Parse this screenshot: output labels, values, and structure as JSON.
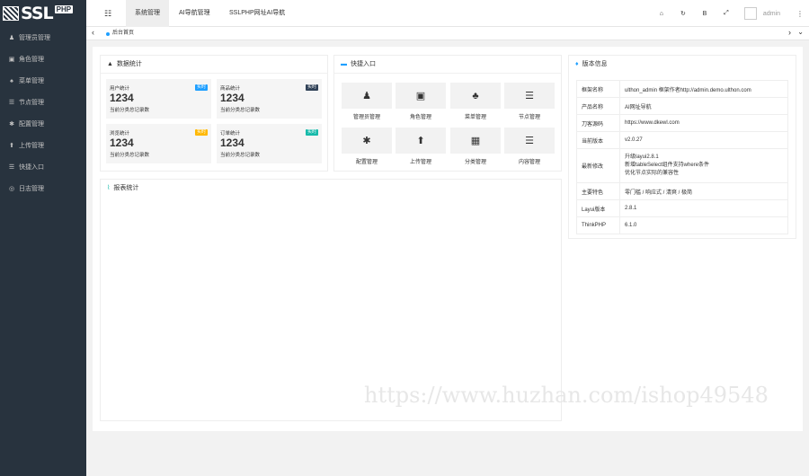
{
  "logo": {
    "text": "SSL",
    "sub": "PHP"
  },
  "sidebar": {
    "items": [
      {
        "label": "管理员管理",
        "icon": "♟"
      },
      {
        "label": "角色管理",
        "icon": "▣"
      },
      {
        "label": "菜单管理",
        "icon": "♠"
      },
      {
        "label": "节点管理",
        "icon": "☰"
      },
      {
        "label": "配置管理",
        "icon": "✱"
      },
      {
        "label": "上传管理",
        "icon": "⬆"
      },
      {
        "label": "快捷入口",
        "icon": "☰"
      },
      {
        "label": "日志管理",
        "icon": "◎"
      }
    ]
  },
  "header": {
    "menu_icon": "☷",
    "tabs": [
      "系统管理",
      "AI导航管理",
      "SSLPHP网址AI导航"
    ],
    "icons": [
      "⌂",
      "↻",
      "B",
      "⤢"
    ],
    "user": "admin",
    "dots": "⋮"
  },
  "tabbar": {
    "left": "‹",
    "tab": "后台首页",
    "right1": "›",
    "right2": "⌄"
  },
  "stats_card": {
    "title": "数据统计",
    "items": [
      {
        "label": "用户统计",
        "badge": "实时",
        "badge_color": "#1e9fff",
        "value": "1234",
        "desc": "当前分类总记录数"
      },
      {
        "label": "商品统计",
        "badge": "实时",
        "badge_color": "#2f4056",
        "value": "1234",
        "desc": "当前分类总记录数"
      },
      {
        "label": "浏览统计",
        "badge": "实时",
        "badge_color": "#ffb800",
        "value": "1234",
        "desc": "当前分类总记录数"
      },
      {
        "label": "订单统计",
        "badge": "实时",
        "badge_color": "#16baaa",
        "value": "1234",
        "desc": "当前分类总记录数"
      }
    ]
  },
  "quick_card": {
    "title": "快捷入口",
    "items": [
      {
        "label": "管理员管理",
        "icon": "♟"
      },
      {
        "label": "角色管理",
        "icon": "▣"
      },
      {
        "label": "菜单管理",
        "icon": "♣"
      },
      {
        "label": "节点管理",
        "icon": "☰"
      },
      {
        "label": "配置管理",
        "icon": "✱"
      },
      {
        "label": "上传管理",
        "icon": "⬆"
      },
      {
        "label": "分类管理",
        "icon": "▦"
      },
      {
        "label": "内容管理",
        "icon": "☰"
      }
    ]
  },
  "report_card": {
    "title": "报表统计"
  },
  "version_card": {
    "title": "版本信息",
    "rows": [
      {
        "key": "框架名称",
        "val": "ulthon_admin 框架作者http://admin.demo.ulthon.com"
      },
      {
        "key": "产品名称",
        "val": "AI网址导航"
      },
      {
        "key": "刀客源码",
        "val": "https://www.dkewl.com"
      },
      {
        "key": "当前版本",
        "val": "v2.0.27"
      },
      {
        "key": "最新修改",
        "val": "升级layui2.8.1\n新增tableSelect组件支持where条件\n优化节点实际的兼容性"
      },
      {
        "key": "主要特色",
        "val": "零门槛 / 响应式 / 清爽 / 极简"
      },
      {
        "key": "Layui版本",
        "val": "2.8.1"
      },
      {
        "key": "ThinkPHP",
        "val": "6.1.0"
      }
    ]
  },
  "watermark": "https://www.huzhan.com/ishop49548",
  "colors": {
    "sidebar": "#28333e",
    "accent": "#1e9fff"
  }
}
